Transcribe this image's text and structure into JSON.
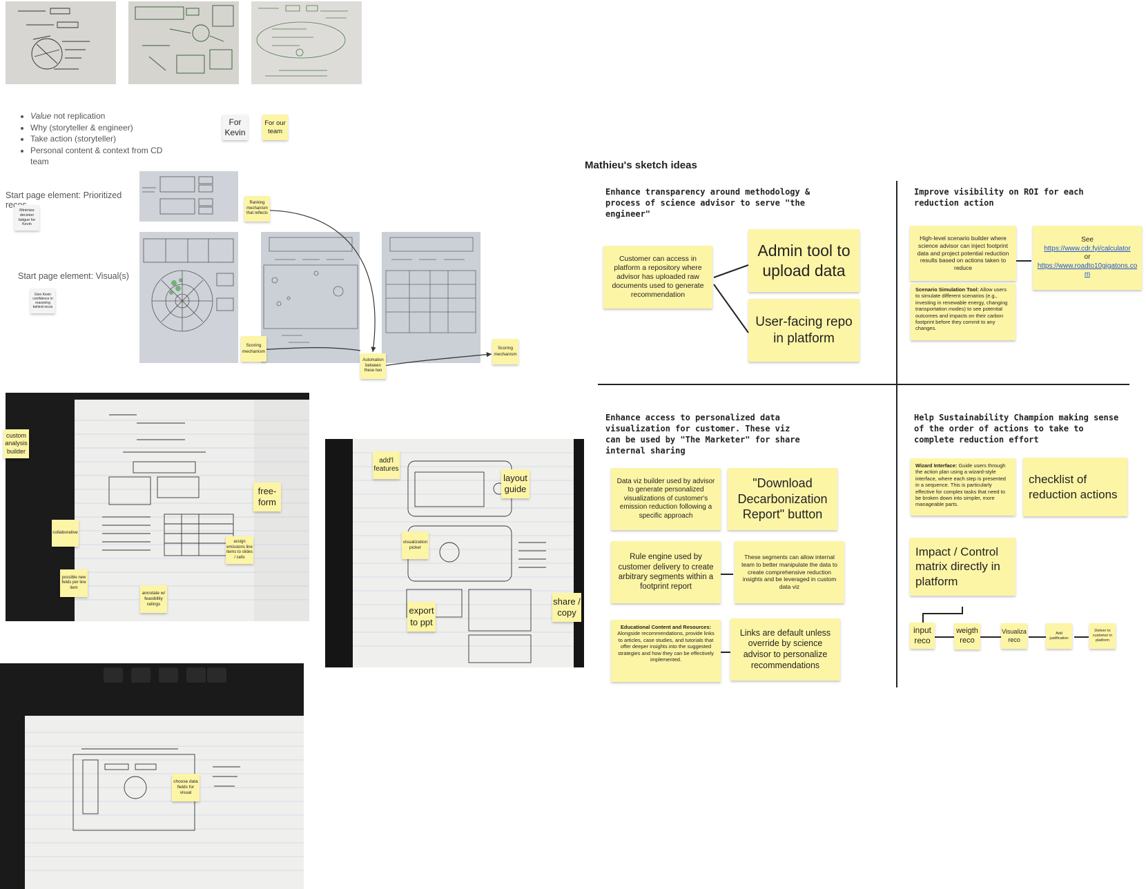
{
  "bullets": {
    "items": [
      {
        "em": "Value",
        "rest": " not replication"
      },
      {
        "em": "",
        "rest": "Why (storyteller & engineer)"
      },
      {
        "em": "",
        "rest": "Take action (storyteller)"
      },
      {
        "em": "",
        "rest": "Personal content & context from CD team"
      }
    ]
  },
  "stickies_top": {
    "for_kevin": "For Kevin",
    "for_team": "For our team"
  },
  "start_page": {
    "label1": "Start page element: Prioritized recos",
    "note1": "Minimize decision fatigue for Kevin",
    "label2": "Start page element: Visual(s)",
    "note2": "Give Kevin confidence in reasoning behind recos"
  },
  "flow_notes": {
    "ranking": "Ranking mechanism that reflects",
    "scoring_left": "Scoring mechanism",
    "automation": "Automation between these two",
    "scoring_right": "Scoring mechanism"
  },
  "sketch_notes": {
    "custom_analysis": "custom analysis builder",
    "free_form": "free-form",
    "collaborative": "collaborative",
    "assign_emissions": "assign emissions line items to slides / cells",
    "possible_fields": "possible new fields per line item",
    "annotate": "annotate w/ feasibility ratings",
    "addl_features": "add'l features",
    "layout_guide": "layout guide",
    "viz_picker": "visualization picker",
    "export_ppt": "export to ppt",
    "share_copy": "share / copy",
    "choose_fields": "choose data fields for visual"
  },
  "mathieu": {
    "title": "Mathieu's sketch ideas",
    "q1": {
      "heading": "Enhance transparency around methodology & process of science advisor to serve \"the engineer\"",
      "note_repo": "Customer can access in platform a repository where advisor has uploaded raw documents used to generate recommendation",
      "note_admin": "Admin tool to upload data",
      "note_user": "User-facing repo in platform"
    },
    "q2": {
      "heading": "Improve visibility on ROI for each reduction action",
      "note_builder": "High-level scenario builder where science advisor can inject footprint data and project potential reduction results based on actions taken to reduce",
      "see": "See",
      "link1": "https://www.cdr.fyi/calculator",
      "or": "or",
      "link2": "https://www.roadto10gigatons.com",
      "sim_bold": "Scenario Simulation Tool:",
      "sim_rest": " Allow users to simulate different scenarios (e.g., investing in renewable energy, changing transportation modes) to see potential outcomes and impacts on their carbon footprint before they commit to any changes."
    },
    "q3": {
      "heading": "Enhance access to personalized data visualization for customer. These viz can be used by \"The Marketer\" for share internal sharing",
      "note_dataviz": "Data viz builder used by advisor to generate personalized visualizations of customer's emission reduction following a specific approach",
      "note_download": "\"Download Decarbonization Report\" button",
      "note_rule": "Rule engine used by customer delivery to create arbitrary segments within a footprint report",
      "note_segments": "These segments can allow internal team to better manipulate the data to create comprehensive reduction insights and be leveraged in custom data viz",
      "edu_bold": "Educational Content and Resources:",
      "edu_rest": " Alongside recommendations, provide links to articles, case studies, and tutorials that offer deeper insights into the suggested strategies and how they can be effectively implemented.",
      "note_links": "Links are default unless override by science advisor to personalize recommendations"
    },
    "q4": {
      "heading": "Help Sustainability Champion making sense of the order of actions to take to complete reduction effort",
      "wiz_bold": "Wizard Interface:",
      "wiz_rest": " Guide users through the action plan using a wizard-style interface, where each step is presented in a sequence. This is particularly effective for complex tasks that need to be broken down into simpler, more manageable parts.",
      "checklist": "checklist of reduction actions",
      "matrix": "Impact / Control matrix directly in platform",
      "flow": [
        "input reco",
        "weigth reco",
        "Visualiza reco",
        "Add justification",
        "Deliver to customer in platform"
      ]
    }
  }
}
